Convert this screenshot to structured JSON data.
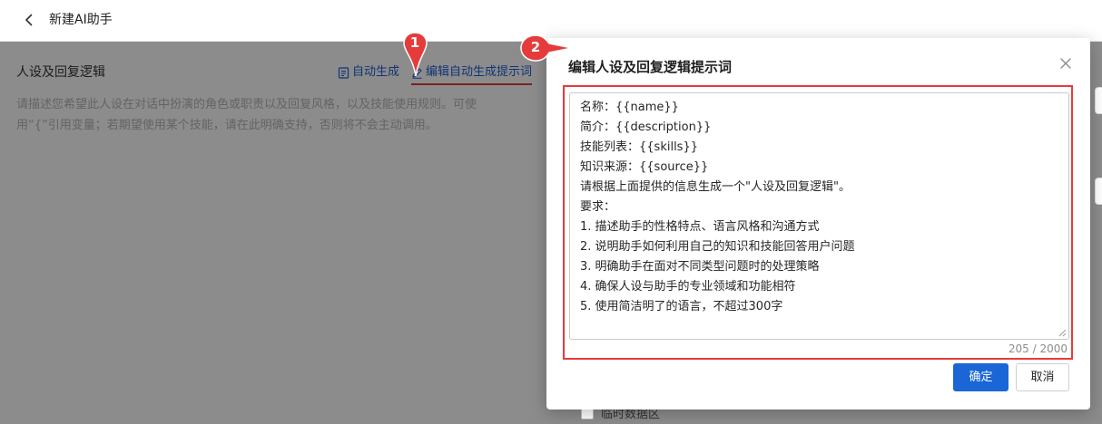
{
  "header": {
    "title": "新建AI助手"
  },
  "persona_section": {
    "title": "人设及回复逻辑",
    "auto_generate_label": "自动生成",
    "edit_prompt_label": "编辑自动生成提示词",
    "placeholder_line1": "请描述您希望此人设在对话中扮演的角色或职责以及回复风格，以及技能使用规则。可使",
    "placeholder_line2": "用“{”引用变量；若期望使用某个技能，请在此明确支持，否则将不会主动调用。"
  },
  "background": {
    "checkbox_label": "临时数据区"
  },
  "markers": [
    "1",
    "2"
  ],
  "modal": {
    "title": "编辑人设及回复逻辑提示词",
    "prompt_lines": [
      "名称：{{name}}",
      "简介：{{description}}",
      "技能列表：{{skills}}",
      "知识来源：{{source}}",
      "请根据上面提供的信息生成一个\"人设及回复逻辑\"。",
      "要求：",
      "1. 描述助手的性格特点、语言风格和沟通方式",
      "2. 说明助手如何利用自己的知识和技能回答用户问题",
      "3. 明确助手在面对不同类型问题时的处理策略",
      "4. 确保人设与助手的专业领域和功能相符",
      "5. 使用简洁明了的语言，不超过300字"
    ],
    "char_count": "205 / 2000",
    "confirm_label": "确定",
    "cancel_label": "取消"
  },
  "colors": {
    "primary": "#1a66d6",
    "link": "#1f5fd1",
    "highlight_red": "#e53b3b",
    "overlay": "rgba(0,0,0,0.45)"
  },
  "icons": {
    "back": "chevron-left-icon",
    "auto_generate": "document-icon",
    "edit": "pencil-icon",
    "close": "close-icon",
    "resize": "resize-handle-icon"
  }
}
